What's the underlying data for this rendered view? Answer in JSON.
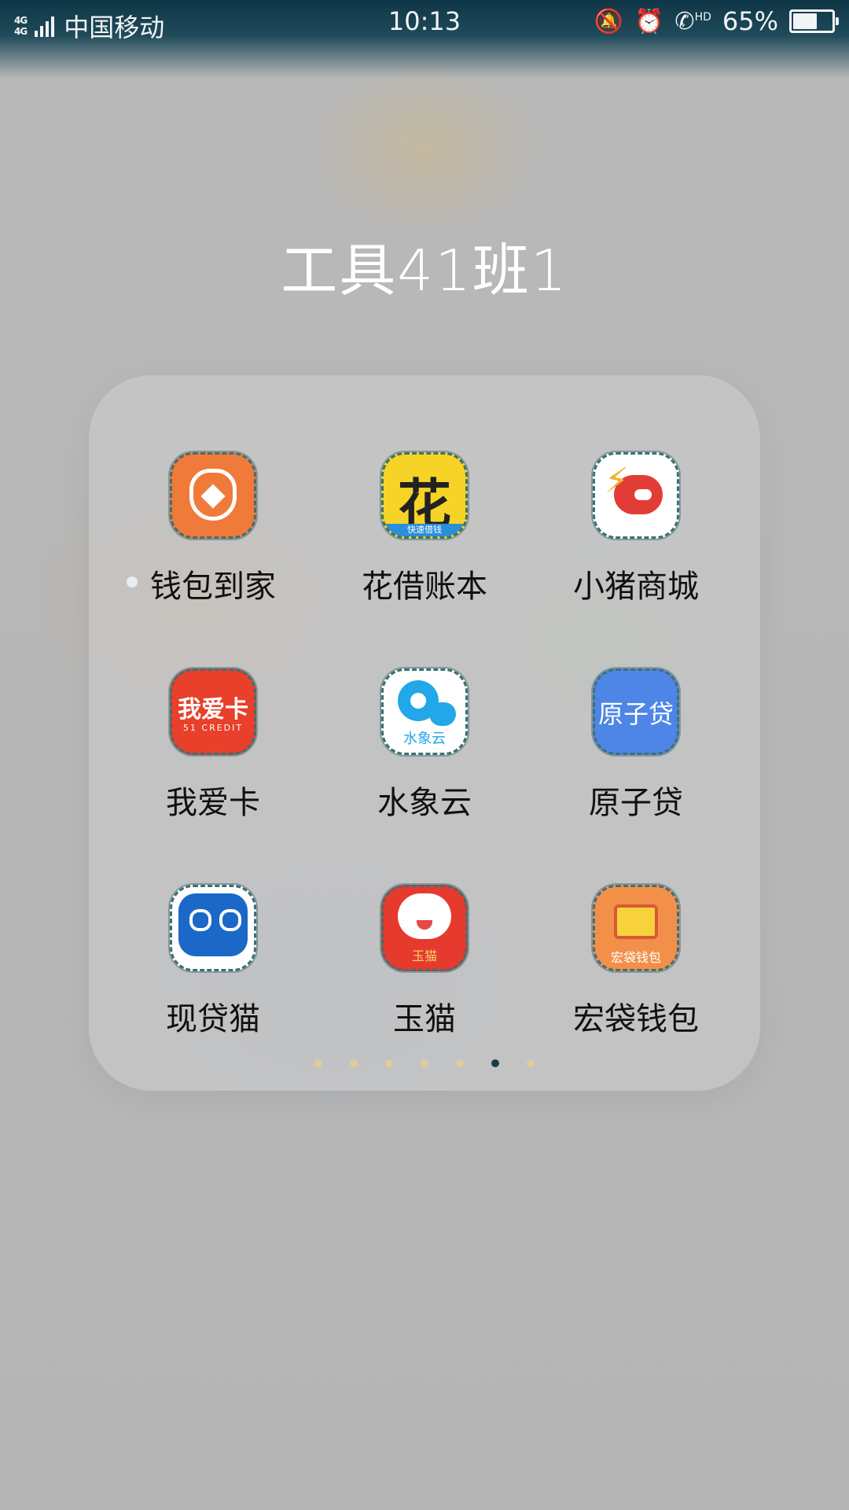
{
  "status_bar": {
    "network_1": "4G",
    "network_2": "4G",
    "carrier": "中国移动",
    "time": "10:13",
    "hd": "HD",
    "battery_percent": "65%",
    "battery_level": 0.65,
    "icons": [
      "mute-bell-icon",
      "alarm-icon",
      "hd-call-icon",
      "battery-icon"
    ]
  },
  "folder": {
    "title": "工具41班1",
    "apps": [
      {
        "label": "钱包到家",
        "icon": "money-bag-icon",
        "new": true,
        "icon_text": ""
      },
      {
        "label": "花借账本",
        "icon": "hua-icon",
        "icon_text": "花",
        "icon_subtext": "快速借钱"
      },
      {
        "label": "小猪商城",
        "icon": "pig-icon",
        "icon_text": ""
      },
      {
        "label": "我爱卡",
        "icon": "51credit-icon",
        "icon_text": "我爱卡",
        "icon_subtext": "51 CREDIT"
      },
      {
        "label": "水象云",
        "icon": "cloud-icon",
        "icon_text": "水象云"
      },
      {
        "label": "原子贷",
        "icon": "yuanzidai-icon",
        "icon_text": "原子贷"
      },
      {
        "label": "现贷猫",
        "icon": "cat-face-icon",
        "icon_text": ""
      },
      {
        "label": "玉猫",
        "icon": "cartoon-cat-icon",
        "icon_text": "玉猫"
      },
      {
        "label": "宏袋钱包",
        "icon": "wallet-icon",
        "icon_text": "宏袋钱包"
      }
    ],
    "pager": {
      "count": 7,
      "active_index": 5
    }
  },
  "colors": {
    "statusbar": "#0f3646",
    "background": "#b7b7b9",
    "panel": "#cdcdd0",
    "pager_dot": "#e0cc9a",
    "pager_active": "#1b3b49"
  }
}
